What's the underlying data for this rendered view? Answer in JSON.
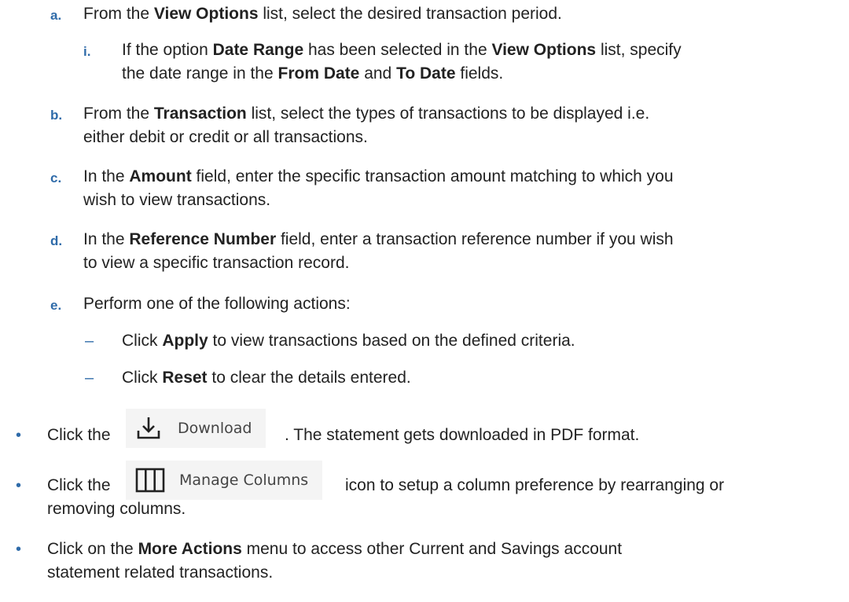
{
  "steps": {
    "a": {
      "marker": "a.",
      "t1": "From the ",
      "b1": "View Options",
      "t2": " list, select the desired transaction period."
    },
    "i": {
      "marker": "i.",
      "t1": "If the option ",
      "b1": "Date Range",
      "t2": " has been selected in the ",
      "b2": "View Options",
      "t3": " list, specify",
      "l2t1": "the date range in the ",
      "l2b1": "From Date",
      "l2t2": " and ",
      "l2b2": "To Date",
      "l2t3": " fields."
    },
    "b": {
      "marker": "b.",
      "t1": "From the ",
      "b1": "Transaction",
      "t2": " list, select the types of transactions to be displayed i.e.",
      "l2": "either debit or credit or all transactions."
    },
    "c": {
      "marker": "c.",
      "t1": "In the ",
      "b1": "Amount",
      "t2": " field, enter the specific transaction amount matching to which you",
      "l2": "wish to view transactions."
    },
    "d": {
      "marker": "d.",
      "t1": "In the ",
      "b1": "Reference Number",
      "t2": " field, enter a transaction reference number if you wish",
      "l2": "to view a specific transaction record."
    },
    "e": {
      "marker": "e.",
      "text": "Perform one of the following actions:"
    },
    "apply": {
      "dash": "–",
      "t1": "Click ",
      "b1": "Apply",
      "t2": " to view transactions based on the defined criteria."
    },
    "reset": {
      "dash": "–",
      "t1": "Click ",
      "b1": "Reset",
      "t2": " to clear the details entered."
    }
  },
  "bullets": {
    "download": {
      "marker": "•",
      "t1": "Click the",
      "button_label": "Download",
      "button_icon": "download-icon",
      "t2": ". The statement gets downloaded in PDF format."
    },
    "manage": {
      "marker": "•",
      "t1": "Click the",
      "button_label": "Manage Columns",
      "button_icon": "columns-icon",
      "t2": "icon to setup a column preference by rearranging or",
      "l2": "removing columns."
    },
    "more": {
      "marker": "•",
      "t1": "Click on the ",
      "b1": "More Actions",
      "t2": " menu to access other Current and Savings account",
      "l2": "statement related transactions."
    }
  },
  "colors": {
    "marker": "#2f6ba9",
    "text": "#222222",
    "button_bg": "#f4f4f4"
  }
}
